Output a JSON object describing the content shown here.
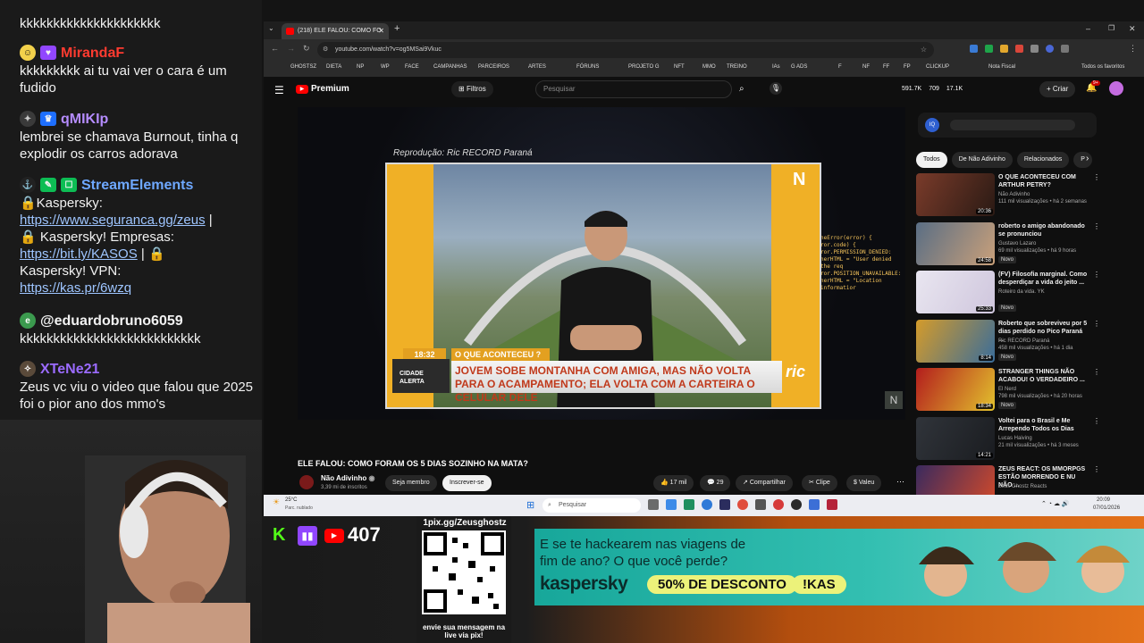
{
  "chat": {
    "messages": [
      {
        "user": "",
        "text": "kkkkkkkkkkkkkkkkkkkkk",
        "color": "#f2f2f2"
      },
      {
        "user": "MirandaF",
        "text": "kkkkkkkkk ai tu vai ver o cara é um fudido",
        "color": "#ff3b30"
      },
      {
        "user": "qMIKIp",
        "text": "lembrei se chamava Burnout, tinha q explodir os carros adorava",
        "color": "#b58cff"
      },
      {
        "user": "StreamElements",
        "color": "#6ea8ff",
        "lines": [
          {
            "pre": "🔒Kaspersky:",
            "link": "https://www.seguranca.gg/zeus",
            "post": " |"
          },
          {
            "pre": "🔒 Kaspersky! Empresas:",
            "link": "https://bit.ly/KASOS",
            "post": " | 🔒"
          },
          {
            "pre": "Kaspersky! VPN:",
            "link": "https://kas.pr/6wzq",
            "post": ""
          }
        ]
      },
      {
        "user": "@eduardobruno6059",
        "text": "kkkkkkkkkkkkkkkkkkkkkkkkkkk",
        "color": "#f2f2f2"
      },
      {
        "user": "XTeNe21",
        "text": "Zeus vc viu o video que falou que 2025 foi o pior ano dos mmo's",
        "color": "#9b6bff"
      }
    ]
  },
  "browser": {
    "tab_title": "(218) ELE FALOU: COMO FO",
    "url": "youtube.com/watch?v=og5MSai9Vkuc",
    "bookmarks": [
      "GHOSTSZ",
      "DIETA",
      "NP",
      "WP",
      "FACE",
      "CAMPANHAS",
      "PARCEIROS",
      "ARTES",
      "FÓRUNS",
      "PROJETO G",
      "NFT",
      "MMO",
      "TREINO",
      "IAs",
      "G ADS",
      "F",
      "NF",
      "FF",
      "FP",
      "CLICKUP",
      "Nota Fiscal",
      "Todos os favoritos"
    ]
  },
  "youtube": {
    "logo": "Premium",
    "filters_label": "Filtros",
    "search_placeholder": "Pesquisar",
    "stats": [
      "591.7K",
      "709",
      "17.1K"
    ],
    "create_label": "Criar",
    "notif_count": "9+",
    "video": {
      "repro_label": "Reprodução: Ric RECORD Paraná",
      "time": "18:32",
      "section": "O QUE ACONTECEU ?",
      "headline": "JOVEM SOBE MONTANHA COM AMIGA, MAS NÃO VOLTA PARA O ACAMPAMENTO; ELA VOLTA COM A CARTEIRA O CELULAR DELE",
      "program": "CIDADE ALERTA",
      "brand": "ric",
      "console_lines": [
        "neError(error) {",
        "ror.code) {",
        "ror.PERMISSION_DENIED:",
        "nerHTML = \"User denied the req",
        "ror.POSITION_UNAVAILABLE:",
        "nerHTML = \"Location informatior"
      ]
    },
    "title": "ELE FALOU: COMO FORAM OS 5 DIAS SOZINHO NA MATA?",
    "channel": "Não Adivinho",
    "subs": "3,39 mi de inscritos",
    "member_label": "Seja membro",
    "subscribe_label": "Inscrever-se",
    "likes": "17 mil",
    "comments": "29",
    "share_label": "Compartilhar",
    "clip_label": "Clipe",
    "thanks_label": "Valeu",
    "chips": [
      "Todos",
      "De Não Adivinho",
      "Relacionados",
      "P"
    ],
    "recs": [
      {
        "title": "O QUE ACONTECEU COM ARTHUR PETRY?",
        "channel": "Não Adivinho",
        "meta": "111 mil visualizações • há 2 semanas",
        "dur": "20:36",
        "novo": false,
        "c1": "#7a3b2a",
        "c2": "#2a1a14"
      },
      {
        "title": "roberto o amigo abandonado se pronunciou",
        "channel": "Gustavo Lazaro",
        "meta": "69 mil visualizações • há 9 horas",
        "dur": "24:58",
        "novo": true,
        "c1": "#5a6e84",
        "c2": "#c9a07a"
      },
      {
        "title": "(FV) Filosofia marginal. Como desperdiçar a vida do jeito ...",
        "channel": "Roteiro da vida. YK",
        "meta": "",
        "dur": "25:33",
        "novo": true,
        "c1": "#e9e6f0",
        "c2": "#cfc6dd"
      },
      {
        "title": "Roberto que sobreviveu por 5 dias perdido no Pico Paraná ...",
        "channel": "Ric RECORD Paraná",
        "meta": "458 mil visualizações • há 1 dia",
        "dur": "8:14",
        "novo": true,
        "c1": "#d49b2a",
        "c2": "#3a6d9a"
      },
      {
        "title": "STRANGER THINGS NÃO ACABOU! O VERDADEIRO ...",
        "channel": "El Nerd",
        "meta": "798 mil visualizações • há 20 horas",
        "dur": "18:34",
        "novo": true,
        "c1": "#b31d1d",
        "c2": "#e2c12d"
      },
      {
        "title": "Voltei para o Brasil e Me Arrependo Todos os Dias",
        "channel": "Lucas Haiving",
        "meta": "21 mil visualizações • há 3 meses",
        "dur": "14:21",
        "novo": false,
        "c1": "#30343a",
        "c2": "#1a1c20"
      },
      {
        "title": "ZEUS REACT: OS MMORPGS ESTÃO MORRENDO E NU NÃO ...",
        "channel": "Zeus Ghostz Reacts",
        "meta": "",
        "dur": "",
        "novo": false,
        "c1": "#3a2a5e",
        "c2": "#d34a2a"
      }
    ]
  },
  "taskbar": {
    "temp": "25°C",
    "weather": "Parc. nublado",
    "search": "Pesquisar",
    "time": "20:09",
    "date": "07/01/2026"
  },
  "overlay": {
    "followers": "407",
    "pix_url": "1pix.gg/Zeusghostz",
    "pix_caption": "envie sua mensagem na live via pix!",
    "ad_line1": "E se te hackearem nas viagens de",
    "ad_line2": "fim de ano? O que você perde?",
    "ad_brand": "kaspersky",
    "ad_discount": "50% DE DESCONTO",
    "ad_cmd": "!KAS"
  }
}
